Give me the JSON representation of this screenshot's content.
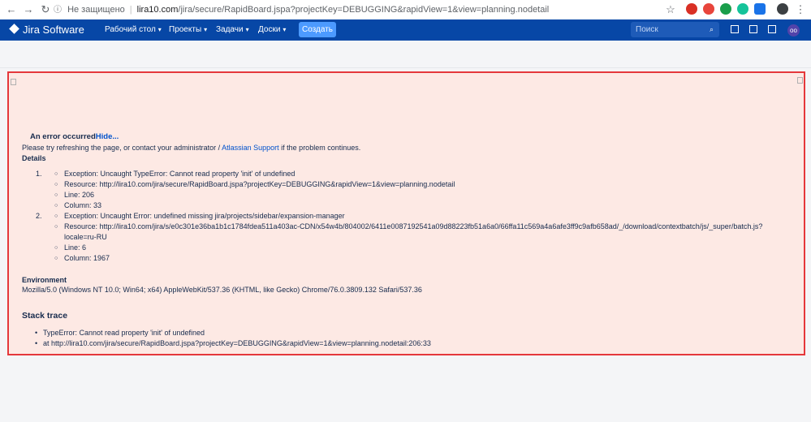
{
  "browser": {
    "back_icon": "arrow-left-icon",
    "forward_icon": "arrow-right-icon",
    "reload_icon": "reload-icon",
    "security_label": "Не защищено",
    "url_host": "lira10.com",
    "url_path": "/jira/secure/RapidBoard.jspa?projectKey=DEBUGGING&rapidView=1&view=planning.nodetail"
  },
  "header": {
    "logo": "Jira Software",
    "nav": [
      "Рабочий стол",
      "Проекты",
      "Задачи",
      "Доски"
    ],
    "create_label": "Создать",
    "search_placeholder": "Поиск",
    "avatar_initials": "oo"
  },
  "error": {
    "title": "An error occurred",
    "hide_link": "Hide...",
    "msg_before": "Please try refreshing the page, or contact your administrator / ",
    "msg_link": "Atlassian Support",
    "msg_after": " if the problem continues.",
    "details_heading": "Details",
    "details": [
      {
        "num": "1.",
        "exception": "Exception: Uncaught TypeError: Cannot read property 'init' of undefined",
        "resource": "Resource: http://lira10.com/jira/secure/RapidBoard.jspa?projectKey=DEBUGGING&rapidView=1&view=planning.nodetail",
        "resource2": "",
        "line": "Line: 206",
        "column": "Column: 33"
      },
      {
        "num": "2.",
        "exception": "Exception: Uncaught Error: undefined missing jira/projects/sidebar/expansion-manager",
        "resource": "Resource: http://lira10.com/jira/s/e0c301e36ba1b1c1784fdea511a403ac-CDN/x54w4b/804002/6411e0087192541a09d88223fb51a6a0/66ffa11c569a4a6afe3ff9c9afb658ad/_/download/contextbatch/js/_super/batch.js?",
        "resource2": "locale=ru-RU",
        "line": "Line: 6",
        "column": "Column: 1967"
      }
    ],
    "env_heading": "Environment",
    "env_text": "Mozilla/5.0 (Windows NT 10.0; Win64; x64) AppleWebKit/537.36 (KHTML, like Gecko) Chrome/76.0.3809.132 Safari/537.36",
    "stack_heading": "Stack trace",
    "stack": [
      "TypeError: Cannot read property 'init' of undefined",
      "at http://lira10.com/jira/secure/RapidBoard.jspa?projectKey=DEBUGGING&rapidView=1&view=planning.nodetail:206:33"
    ]
  },
  "colors": {
    "header_bg": "#0747a6",
    "create_bg": "#4c9aff",
    "panel_bg": "#fde9e4",
    "panel_border": "#e5383b",
    "link": "#0052cc"
  }
}
